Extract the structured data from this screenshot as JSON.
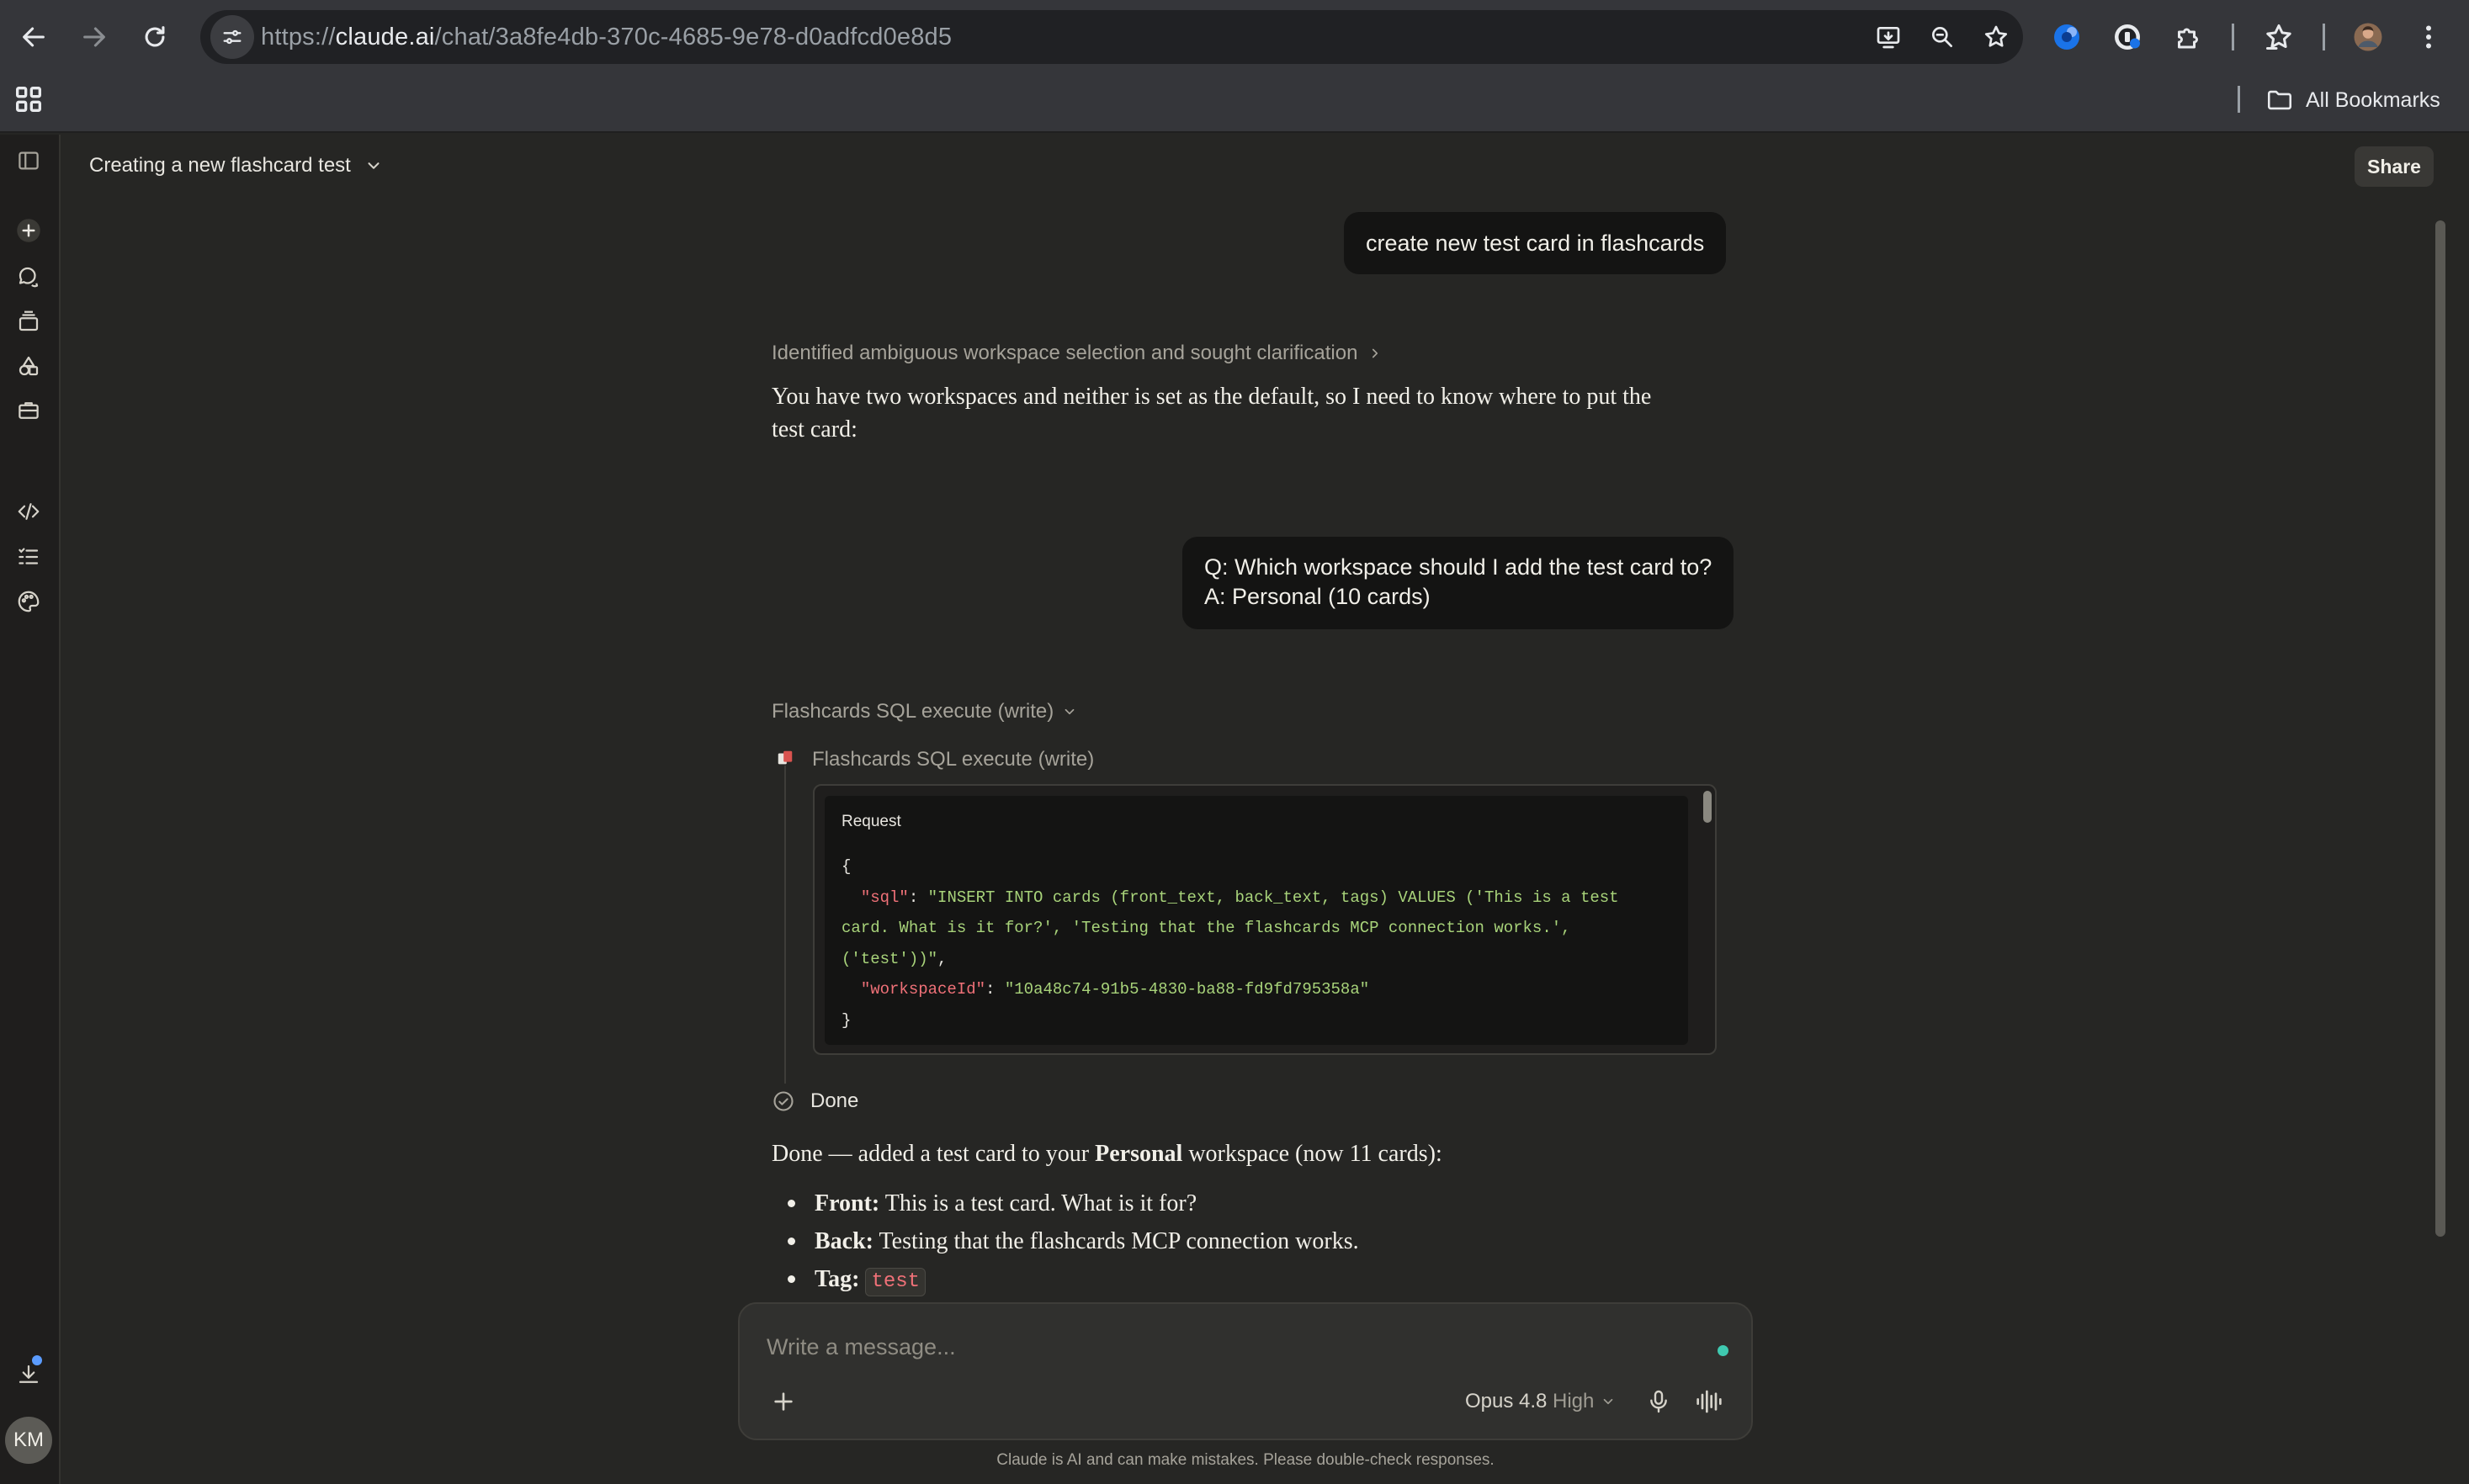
{
  "browser": {
    "url_prefix": "https://",
    "url_host": "claude.ai",
    "url_path": "/chat/3a8fe4db-370c-4685-9e78-d0adfcd0e8d5",
    "bookmarks_folder": "All Bookmarks",
    "icons": [
      "back-arrow-icon",
      "forward-arrow-icon",
      "reload-icon",
      "site-settings-icon",
      "install-app-icon",
      "zoom-icon",
      "bookmark-star-icon",
      "extension-icons",
      "puzzle-icon",
      "reading-list-icon",
      "profile-avatar",
      "kebab-menu-icon",
      "apps-grid-icon",
      "folder-icon"
    ]
  },
  "sidebar": {
    "icons": [
      "sidebar-toggle-icon",
      "new-chat-icon",
      "chats-icon",
      "projects-icon",
      "artifacts-icon",
      "briefcase-icon",
      "code-icon",
      "tasks-icon",
      "palette-icon",
      "download-icon"
    ],
    "avatar_initials": "KM"
  },
  "header": {
    "chat_title": "Creating a new flashcard test",
    "share_label": "Share"
  },
  "conversation": {
    "user_msg_1": "create new test card in flashcards",
    "thought_summary": "Identified ambiguous workspace selection and sought clarification",
    "assistant_msg_1_line1": "You have two workspaces and neither is set as the default, so I need to know where to put the",
    "assistant_msg_1_line2": "test card:",
    "user_msg_2_q": "Q: Which workspace should I add the test card to?",
    "user_msg_2_a": "A: Personal (10 cards)",
    "tool_group_label": "Flashcards SQL execute (write)",
    "tool_call_label": "Flashcards SQL execute (write)",
    "request_label": "Request",
    "request_code": {
      "open": "{",
      "sql_key": "\"sql\"",
      "sql_line1": "\"INSERT INTO cards (front_text, back_text, tags) VALUES ('This is a test",
      "sql_line2": "card. What is it for?', 'Testing that the flashcards MCP connection works.',",
      "sql_line3": "('test'))\"",
      "ws_key": "\"workspaceId\"",
      "ws_value": "\"10a48c74-91b5-4830-ba88-fd9fd795358a\"",
      "close": "}"
    },
    "done_label": "Done",
    "result_pre": "Done — added a test card to your ",
    "result_bold": "Personal",
    "result_post": " workspace (now 11 cards):",
    "bullets": [
      {
        "label": "Front:",
        "text": " This is a test card. What is it for?"
      },
      {
        "label": "Back:",
        "text": " Testing that the flashcards MCP connection works."
      },
      {
        "label": "Tag:",
        "code": "test"
      }
    ]
  },
  "composer": {
    "placeholder": "Write a message...",
    "model": "Opus 4.8",
    "effort": "High"
  },
  "disclaimer": "Claude is AI and can make mistakes. Please double-check responses.",
  "colors": {
    "accent_dot": "#3fc9b0",
    "code_key": "#f07178",
    "code_string": "#a8d37a",
    "notification": "#5b9cff"
  }
}
